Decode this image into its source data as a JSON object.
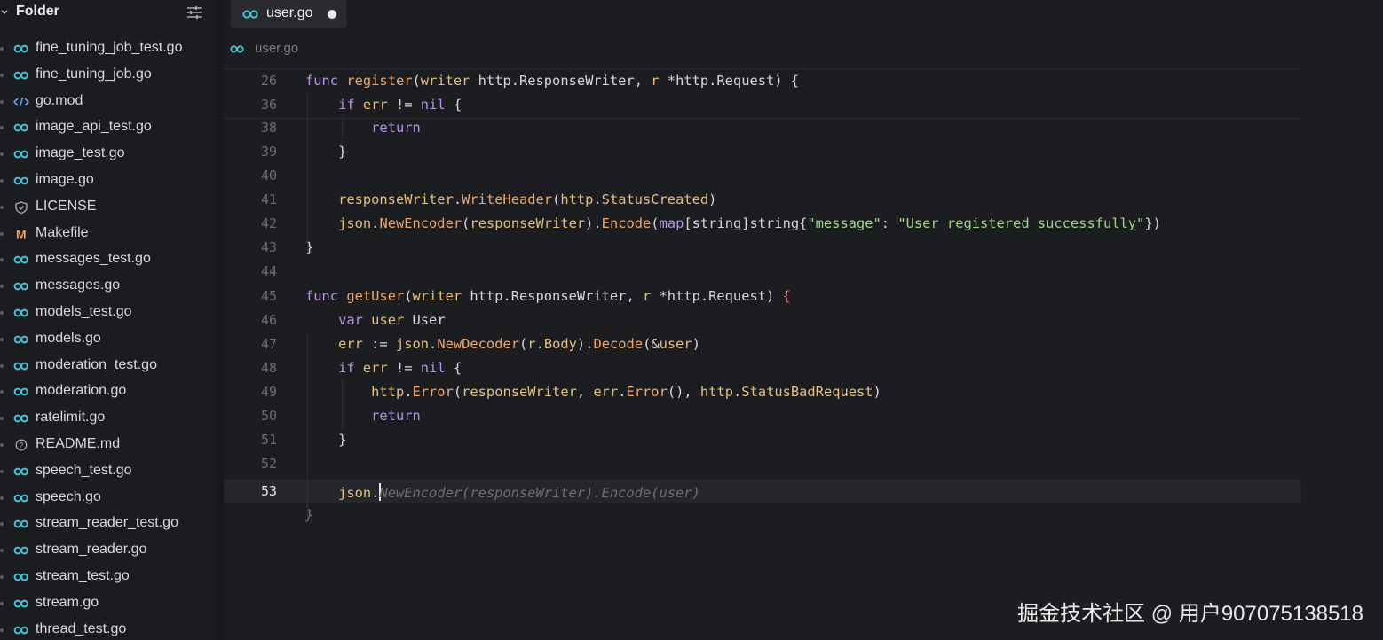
{
  "sidebar": {
    "title": "Folder",
    "files": [
      {
        "name": "fine_tuning_job_test.go",
        "icon": "go-file-icon"
      },
      {
        "name": "fine_tuning_job.go",
        "icon": "go-file-icon"
      },
      {
        "name": "go.mod",
        "icon": "code-file-icon"
      },
      {
        "name": "image_api_test.go",
        "icon": "go-file-icon"
      },
      {
        "name": "image_test.go",
        "icon": "go-file-icon"
      },
      {
        "name": "image.go",
        "icon": "go-file-icon"
      },
      {
        "name": "LICENSE",
        "icon": "license-shield-icon"
      },
      {
        "name": "Makefile",
        "icon": "makefile-m-icon"
      },
      {
        "name": "messages_test.go",
        "icon": "go-file-icon"
      },
      {
        "name": "messages.go",
        "icon": "go-file-icon"
      },
      {
        "name": "models_test.go",
        "icon": "go-file-icon"
      },
      {
        "name": "models.go",
        "icon": "go-file-icon"
      },
      {
        "name": "moderation_test.go",
        "icon": "go-file-icon"
      },
      {
        "name": "moderation.go",
        "icon": "go-file-icon"
      },
      {
        "name": "ratelimit.go",
        "icon": "go-file-icon"
      },
      {
        "name": "README.md",
        "icon": "readme-info-icon"
      },
      {
        "name": "speech_test.go",
        "icon": "go-file-icon"
      },
      {
        "name": "speech.go",
        "icon": "go-file-icon"
      },
      {
        "name": "stream_reader_test.go",
        "icon": "go-file-icon"
      },
      {
        "name": "stream_reader.go",
        "icon": "go-file-icon"
      },
      {
        "name": "stream_test.go",
        "icon": "go-file-icon"
      },
      {
        "name": "stream.go",
        "icon": "go-file-icon"
      },
      {
        "name": "thread_test.go",
        "icon": "go-file-icon"
      }
    ]
  },
  "tab": {
    "label": "user.go",
    "modified": true
  },
  "breadcrumb": {
    "label": "user.go"
  },
  "editor": {
    "current_line": "53",
    "lines": [
      {
        "num": "26",
        "tokens": [
          [
            "kw",
            "func"
          ],
          [
            "id",
            " "
          ],
          [
            "fn",
            "register"
          ],
          [
            "id",
            "("
          ],
          [
            "par",
            "writer"
          ],
          [
            "id",
            " http.ResponseWriter, "
          ],
          [
            "par",
            "r"
          ],
          [
            "id",
            " *http.Request) {"
          ]
        ]
      },
      {
        "num": "36",
        "tokens": [
          [
            "id",
            "    "
          ],
          [
            "kw",
            "if"
          ],
          [
            "id",
            " "
          ],
          [
            "var",
            "err"
          ],
          [
            "id",
            " != "
          ],
          [
            "kw",
            "nil"
          ],
          [
            "id",
            " {"
          ]
        ]
      },
      {
        "num": "38",
        "tokens": [
          [
            "id",
            "        "
          ],
          [
            "kw",
            "return"
          ]
        ]
      },
      {
        "num": "39",
        "tokens": [
          [
            "id",
            "    }"
          ]
        ]
      },
      {
        "num": "40",
        "tokens": []
      },
      {
        "num": "41",
        "tokens": [
          [
            "id",
            "    "
          ],
          [
            "var",
            "responseWriter"
          ],
          [
            "id",
            "."
          ],
          [
            "fn",
            "WriteHeader"
          ],
          [
            "id",
            "("
          ],
          [
            "pkg",
            "http"
          ],
          [
            "id",
            "."
          ],
          [
            "type",
            "StatusCreated"
          ],
          [
            "id",
            ")"
          ]
        ]
      },
      {
        "num": "42",
        "tokens": [
          [
            "id",
            "    "
          ],
          [
            "pkg",
            "json"
          ],
          [
            "id",
            "."
          ],
          [
            "fn",
            "NewEncoder"
          ],
          [
            "id",
            "("
          ],
          [
            "var",
            "responseWriter"
          ],
          [
            "id",
            ")."
          ],
          [
            "fn",
            "Encode"
          ],
          [
            "id",
            "("
          ],
          [
            "kw",
            "map"
          ],
          [
            "id",
            "[string]string{"
          ],
          [
            "str",
            "\"message\""
          ],
          [
            "id",
            ": "
          ],
          [
            "str",
            "\"User registered successfully\""
          ],
          [
            "id",
            "})"
          ]
        ]
      },
      {
        "num": "43",
        "tokens": [
          [
            "id",
            "}"
          ]
        ]
      },
      {
        "num": "44",
        "tokens": []
      },
      {
        "num": "45",
        "tokens": [
          [
            "kw",
            "func"
          ],
          [
            "id",
            " "
          ],
          [
            "fn",
            "getUser"
          ],
          [
            "id",
            "("
          ],
          [
            "par",
            "writer"
          ],
          [
            "id",
            " http.ResponseWriter, "
          ],
          [
            "par",
            "r"
          ],
          [
            "id",
            " *http.Request) "
          ],
          [
            "red",
            "{"
          ]
        ]
      },
      {
        "num": "46",
        "tokens": [
          [
            "id",
            "    "
          ],
          [
            "kw",
            "var"
          ],
          [
            "id",
            " "
          ],
          [
            "var",
            "user"
          ],
          [
            "id",
            " User"
          ]
        ]
      },
      {
        "num": "47",
        "tokens": [
          [
            "id",
            "    "
          ],
          [
            "var",
            "err"
          ],
          [
            "id",
            " := "
          ],
          [
            "pkg",
            "json"
          ],
          [
            "id",
            "."
          ],
          [
            "fn",
            "NewDecoder"
          ],
          [
            "id",
            "("
          ],
          [
            "var",
            "r"
          ],
          [
            "id",
            "."
          ],
          [
            "type",
            "Body"
          ],
          [
            "id",
            ")."
          ],
          [
            "fn",
            "Decode"
          ],
          [
            "id",
            "(&"
          ],
          [
            "var",
            "user"
          ],
          [
            "id",
            ")"
          ]
        ]
      },
      {
        "num": "48",
        "tokens": [
          [
            "id",
            "    "
          ],
          [
            "kw",
            "if"
          ],
          [
            "id",
            " "
          ],
          [
            "var",
            "err"
          ],
          [
            "id",
            " != "
          ],
          [
            "kw",
            "nil"
          ],
          [
            "id",
            " {"
          ]
        ]
      },
      {
        "num": "49",
        "tokens": [
          [
            "id",
            "        "
          ],
          [
            "pkg",
            "http"
          ],
          [
            "id",
            "."
          ],
          [
            "fn",
            "Error"
          ],
          [
            "id",
            "("
          ],
          [
            "var",
            "responseWriter"
          ],
          [
            "id",
            ", "
          ],
          [
            "var",
            "err"
          ],
          [
            "id",
            "."
          ],
          [
            "fn",
            "Error"
          ],
          [
            "id",
            "(), "
          ],
          [
            "pkg",
            "http"
          ],
          [
            "id",
            "."
          ],
          [
            "type",
            "StatusBadRequest"
          ],
          [
            "id",
            ")"
          ]
        ]
      },
      {
        "num": "50",
        "tokens": [
          [
            "id",
            "        "
          ],
          [
            "kw",
            "return"
          ]
        ]
      },
      {
        "num": "51",
        "tokens": [
          [
            "id",
            "    }"
          ]
        ]
      },
      {
        "num": "52",
        "tokens": []
      },
      {
        "num": "53",
        "tokens": [
          [
            "id",
            "    "
          ],
          [
            "pkg",
            "json"
          ],
          [
            "id",
            "."
          ],
          [
            "cursor",
            ""
          ],
          [
            "ghost",
            "NewEncoder(responseWriter).Encode(user)"
          ]
        ]
      },
      {
        "num": "",
        "tokens": [
          [
            "ghost",
            "}"
          ]
        ]
      }
    ]
  },
  "watermark": "掘金技术社区 @ 用户907075138518"
}
